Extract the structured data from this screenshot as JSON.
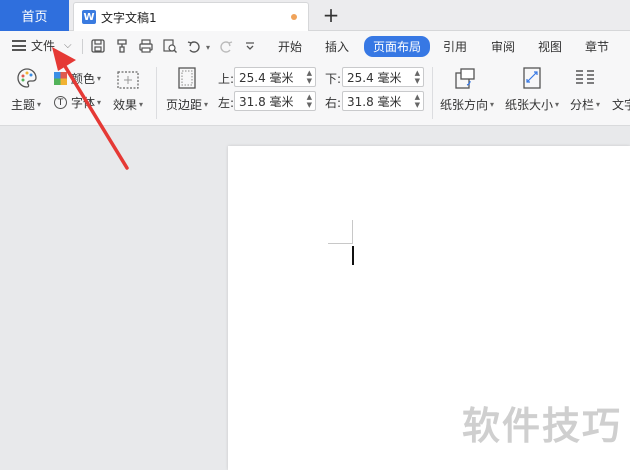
{
  "tabs": {
    "home_label": "首页",
    "doc_icon_letter": "W",
    "doc_title": "文字文稿1",
    "new_tab_symbol": "+"
  },
  "menu": {
    "file_label": "文件",
    "items": [
      "开始",
      "插入",
      "页面布局",
      "引用",
      "审阅",
      "视图",
      "章节"
    ],
    "active_item": "页面布局"
  },
  "ribbon": {
    "theme_label": "主题",
    "color_label": "颜色",
    "font_label": "字体",
    "effect_label": "效果",
    "margin_label": "页边距",
    "top_label": "上:",
    "top_value": "25.4 毫米",
    "bottom_label": "下:",
    "bottom_value": "25.4 毫米",
    "left_label": "左:",
    "left_value": "31.8 毫米",
    "right_label": "右:",
    "right_value": "31.8 毫米",
    "orientation_label": "纸张方向",
    "size_label": "纸张大小",
    "columns_label": "分栏",
    "textdir_label": "文字"
  },
  "watermark": "软件技巧",
  "colors": {
    "accent": "#3778e4",
    "home_tab": "#2f6fdd",
    "annotation_arrow": "#e53935"
  }
}
